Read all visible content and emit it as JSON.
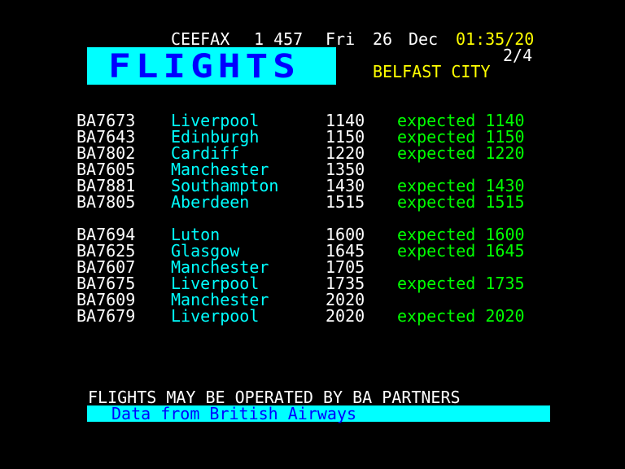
{
  "header": {
    "service": "CEEFAX",
    "page": "1 457",
    "day": "Fri",
    "date_day": "26",
    "month": "Dec",
    "time": "01:35/20",
    "subpage": "2/4",
    "banner": "FLIGHTS",
    "station": "BELFAST CITY"
  },
  "flights": [
    {
      "flight": "BA7673",
      "destination": "Liverpool",
      "time": "1140",
      "status": "expected 1140"
    },
    {
      "flight": "BA7643",
      "destination": "Edinburgh",
      "time": "1150",
      "status": "expected 1150"
    },
    {
      "flight": "BA7802",
      "destination": "Cardiff",
      "time": "1220",
      "status": "expected 1220"
    },
    {
      "flight": "BA7605",
      "destination": "Manchester",
      "time": "1350",
      "status": ""
    },
    {
      "flight": "BA7881",
      "destination": "Southampton",
      "time": "1430",
      "status": "expected 1430"
    },
    {
      "flight": "BA7805",
      "destination": "Aberdeen",
      "time": "1515",
      "status": "expected 1515"
    },
    {
      "flight": "BA7694",
      "destination": "Luton",
      "time": "1600",
      "status": "expected 1600"
    },
    {
      "flight": "BA7625",
      "destination": "Glasgow",
      "time": "1645",
      "status": "expected 1645"
    },
    {
      "flight": "BA7607",
      "destination": "Manchester",
      "time": "1705",
      "status": ""
    },
    {
      "flight": "BA7675",
      "destination": "Liverpool",
      "time": "1735",
      "status": "expected 1735"
    },
    {
      "flight": "BA7609",
      "destination": "Manchester",
      "time": "2020",
      "status": ""
    },
    {
      "flight": "BA7679",
      "destination": "Liverpool",
      "time": "2020",
      "status": "expected 2020"
    }
  ],
  "footer": {
    "note": "FLIGHTS MAY BE OPERATED BY BA PARTNERS",
    "source": "Data from British Airways"
  },
  "colors": {
    "background": "#000000",
    "banner_bg": "#00ffff",
    "banner_text": "#0000ff",
    "destination": "#00ffff",
    "status": "#00ff00",
    "station": "#ffff00",
    "clock": "#ffff00"
  }
}
